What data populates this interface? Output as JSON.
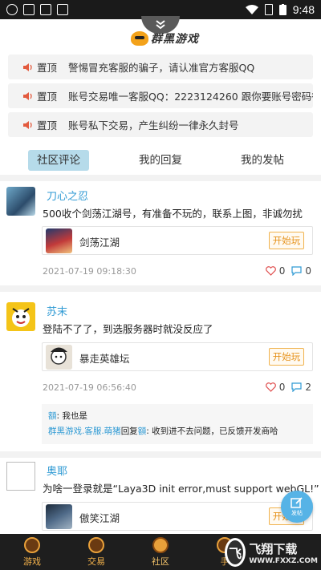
{
  "status_bar": {
    "time": "9:48"
  },
  "header": {
    "logo_text": "群黑游戏",
    "pull_tab_icon": "chevron-double-down-icon"
  },
  "notices": [
    {
      "tag": "置顶",
      "text": "警惕冒充客服的骗子，请认准官方客服QQ"
    },
    {
      "tag": "置顶",
      "text": "账号交易唯一客服QQ：2223124260 跟你要账号密码得"
    },
    {
      "tag": "置顶",
      "text": "账号私下交易，产生纠纷一律永久封号"
    }
  ],
  "tabs": [
    {
      "label": "社区评论"
    },
    {
      "label": "我的回复"
    },
    {
      "label": "我的发帖"
    }
  ],
  "posts": [
    {
      "username": "刀心之忍",
      "content": "500收个剑荡江湖号，有准备不玩的，联系上图，非诚勿扰",
      "game": {
        "name": "剑荡江湖",
        "button": "开始玩"
      },
      "timestamp": "2021-07-19 09:18:30",
      "likes": "0",
      "comments": "0"
    },
    {
      "username": "苏末",
      "content": "登陆不了了，到选服务器时就没反应了",
      "game": {
        "name": "暴走英雄坛",
        "button": "开始玩"
      },
      "timestamp": "2021-07-19 06:56:40",
      "likes": "0",
      "comments": "2",
      "replies": [
        {
          "name": "額",
          "text": ": 我也是"
        },
        {
          "name": "群黑游戏.客服.萌猪",
          "mid": "回复",
          "target": "額",
          "text": ": 收到进不去问题，已反馈开发商哈"
        }
      ]
    },
    {
      "username": "奥耶",
      "content": "为啥一登录就是“Laya3D init error,must support webGL!”",
      "game": {
        "name": "傲笑江湖",
        "button": "开始玩"
      }
    }
  ],
  "fab": {
    "label": "发帖"
  },
  "bottom_nav": [
    {
      "label": "游戏"
    },
    {
      "label": "交易"
    },
    {
      "label": "社区"
    },
    {
      "label": "手"
    }
  ],
  "watermark": {
    "badge": "飞",
    "title": "飞翔下载",
    "url": "WWW.FXXZ.COM"
  },
  "colors": {
    "accent_blue": "#2f9ad4",
    "play_orange": "#e6921b",
    "like_red": "#e05050",
    "tab_active_bg": "#b6dbea"
  }
}
